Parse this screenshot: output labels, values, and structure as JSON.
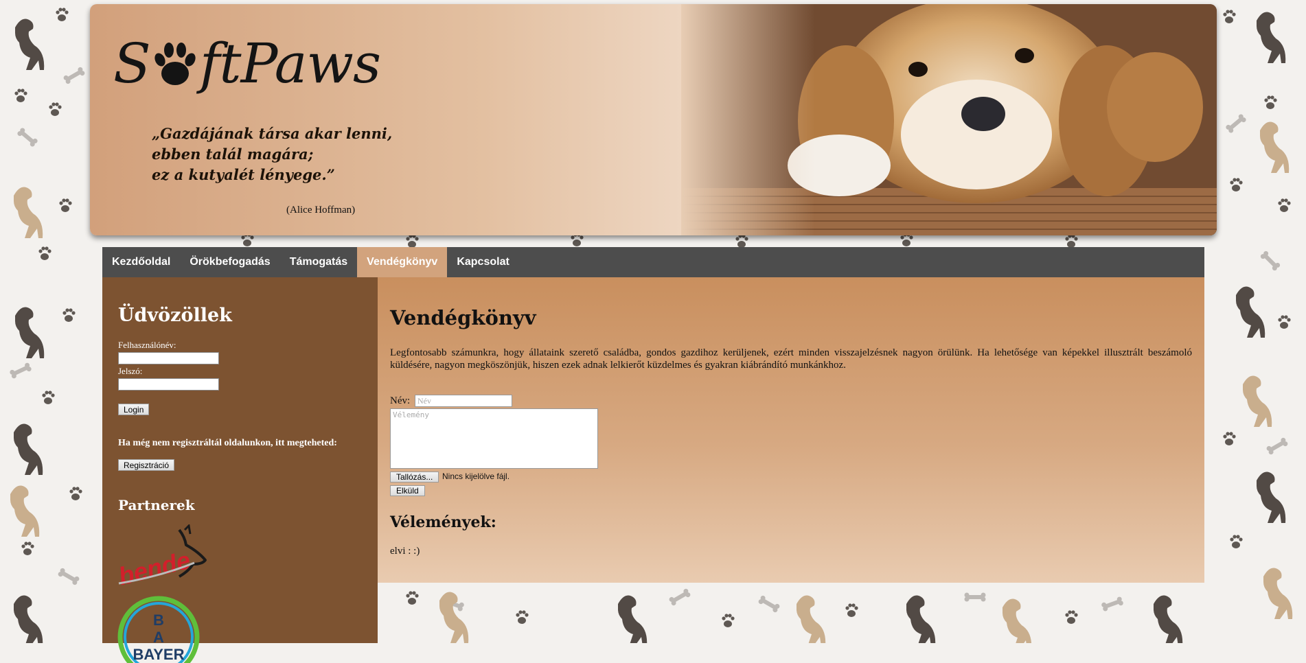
{
  "header": {
    "logo": {
      "part1": "S",
      "part2": "ftPaws"
    },
    "quote_lines": [
      "„Gazdájának társa akar lenni,",
      "ebben talál magára;",
      "ez a kutyalét lényege.”"
    ],
    "author": "(Alice Hoffman)"
  },
  "nav": {
    "items": [
      {
        "label": "Kezdőoldal"
      },
      {
        "label": "Örökbefogadás"
      },
      {
        "label": "Támogatás"
      },
      {
        "label": "Vendégkönyv"
      },
      {
        "label": "Kapcsolat"
      }
    ],
    "active": "Vendégkönyv"
  },
  "sidebar": {
    "welcome": "Üdvözöllek",
    "username_label": "Felhasználónév:",
    "password_label": "Jelszó:",
    "login_button": "Login",
    "register_note": "Ha még nem regisztráltál oldalunkon, itt megteheted:",
    "register_button": "Regisztráció",
    "partners_title": "Partnerek",
    "partner_logos": [
      "bende",
      "BAYER"
    ]
  },
  "main": {
    "title": "Vendégkönyv",
    "intro": "Legfontosabb számunkra, hogy állataink szerető családba, gondos gazdihoz kerüljenek, ezért minden visszajelzésnek nagyon örülünk. Ha lehetősége van képekkel illusztrált beszámoló küldésére, nagyon megköszönjük, hiszen ezek adnak lelkierőt küzdelmes és gyakran kiábrándító munkánkhoz.",
    "form": {
      "name_label": "Név:",
      "name_placeholder": "Név",
      "opinion_placeholder": "Vélemény",
      "browse_button": "Tallózás...",
      "file_status": "Nincs kijelölve fájl.",
      "submit_button": "Elküld"
    },
    "reviews_title": "Vélemények:",
    "reviews": [
      "elvi : :)"
    ]
  },
  "colors": {
    "nav_bg": "#4d4d4d",
    "nav_active": "#d2a37d",
    "sidebar_bg": "#7d5331",
    "main_bg": "#c98f5e"
  }
}
